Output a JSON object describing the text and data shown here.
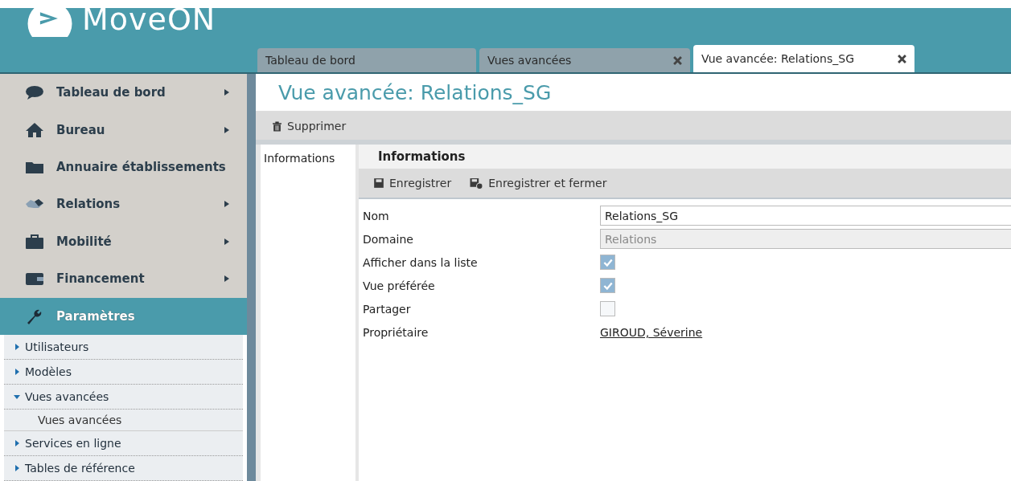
{
  "app": {
    "name": "MoveON"
  },
  "tabs": [
    {
      "label": "Tableau de bord",
      "closable": false,
      "selected": false
    },
    {
      "label": "Vues avancées",
      "closable": true,
      "selected": false
    },
    {
      "label": "Vue avancée: Relations_SG",
      "closable": true,
      "selected": true
    }
  ],
  "sidebar": {
    "items": [
      {
        "label": "Tableau de bord",
        "submenu": true,
        "selected": false
      },
      {
        "label": "Bureau",
        "submenu": true,
        "selected": false
      },
      {
        "label": "Annuaire établissements",
        "submenu": false,
        "selected": false
      },
      {
        "label": "Relations",
        "submenu": true,
        "selected": false
      },
      {
        "label": "Mobilité",
        "submenu": true,
        "selected": false
      },
      {
        "label": "Financement",
        "submenu": true,
        "selected": false
      },
      {
        "label": "Paramètres",
        "submenu": false,
        "selected": true
      }
    ],
    "subitems": [
      {
        "label": "Utilisateurs",
        "expanded": false
      },
      {
        "label": "Modèles",
        "expanded": false
      },
      {
        "label": "Vues avancées",
        "expanded": true,
        "children": [
          {
            "label": "Vues avancées"
          }
        ]
      },
      {
        "label": "Services en ligne",
        "expanded": false
      },
      {
        "label": "Tables de référence",
        "expanded": false
      }
    ]
  },
  "page": {
    "title": "Vue avancée: Relations_SG",
    "toolbar": [
      "Supprimer"
    ],
    "side_tabs": [
      {
        "label": "Informations",
        "selected": true
      }
    ],
    "section": {
      "title": "Informations",
      "actions": [
        "Enregistrer",
        "Enregistrer et fermer"
      ],
      "fields": [
        {
          "label": "Nom",
          "kind": "text",
          "value": "Relations_SG"
        },
        {
          "label": "Domaine",
          "kind": "readonly",
          "value": "Relations"
        },
        {
          "label": "Afficher dans la liste",
          "kind": "checkbox",
          "checked": true
        },
        {
          "label": "Vue préférée",
          "kind": "checkbox",
          "checked": true
        },
        {
          "label": "Partager",
          "kind": "checkbox",
          "checked": false
        },
        {
          "label": "Propriétaire",
          "kind": "link",
          "value": "GIROUD, Séverine"
        }
      ]
    }
  }
}
